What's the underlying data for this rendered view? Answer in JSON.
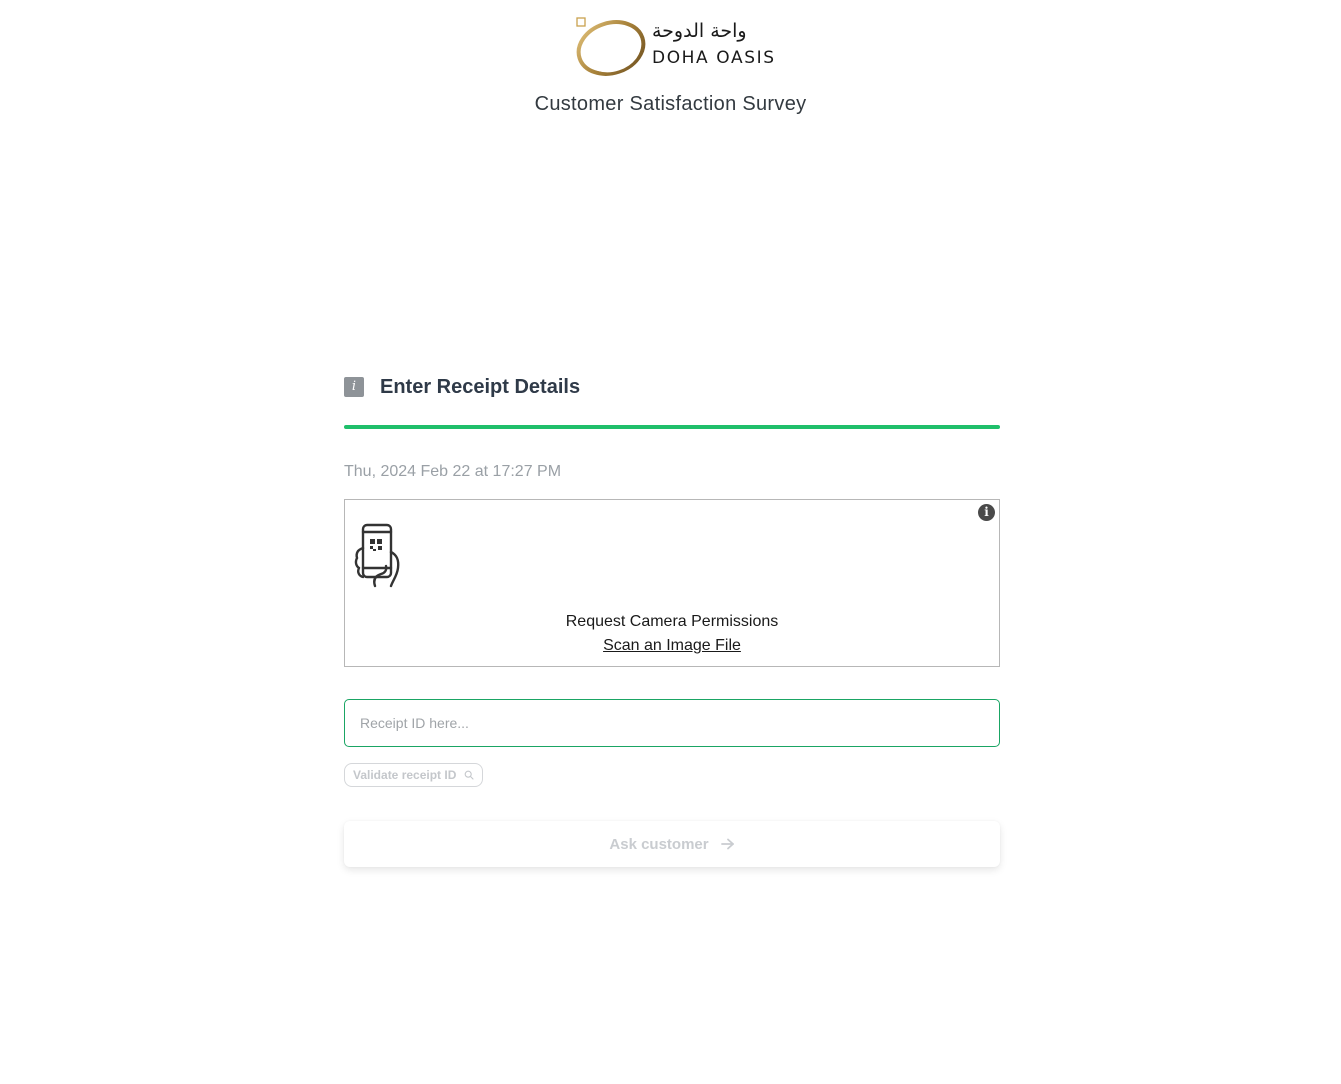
{
  "brand": {
    "logo_arabic": "واحة الدوحة",
    "logo_latin": "DOHA OASIS",
    "subtitle": "Customer Satisfaction Survey",
    "accent_color": "#b08a3e"
  },
  "step": {
    "badge_glyph": "i",
    "title": "Enter Receipt Details",
    "progress_color": "#1fbf6b"
  },
  "timestamp": "Thu, 2024 Feb 22 at 17:27 PM",
  "scanner": {
    "info_glyph": "i",
    "icon": "phone-qr-hand-icon",
    "request_permissions": "Request Camera Permissions",
    "scan_file": "Scan an Image File"
  },
  "receipt": {
    "value": "",
    "placeholder": "Receipt ID here...",
    "validate_label": "Validate receipt ID"
  },
  "actions": {
    "ask_customer": "Ask customer"
  }
}
